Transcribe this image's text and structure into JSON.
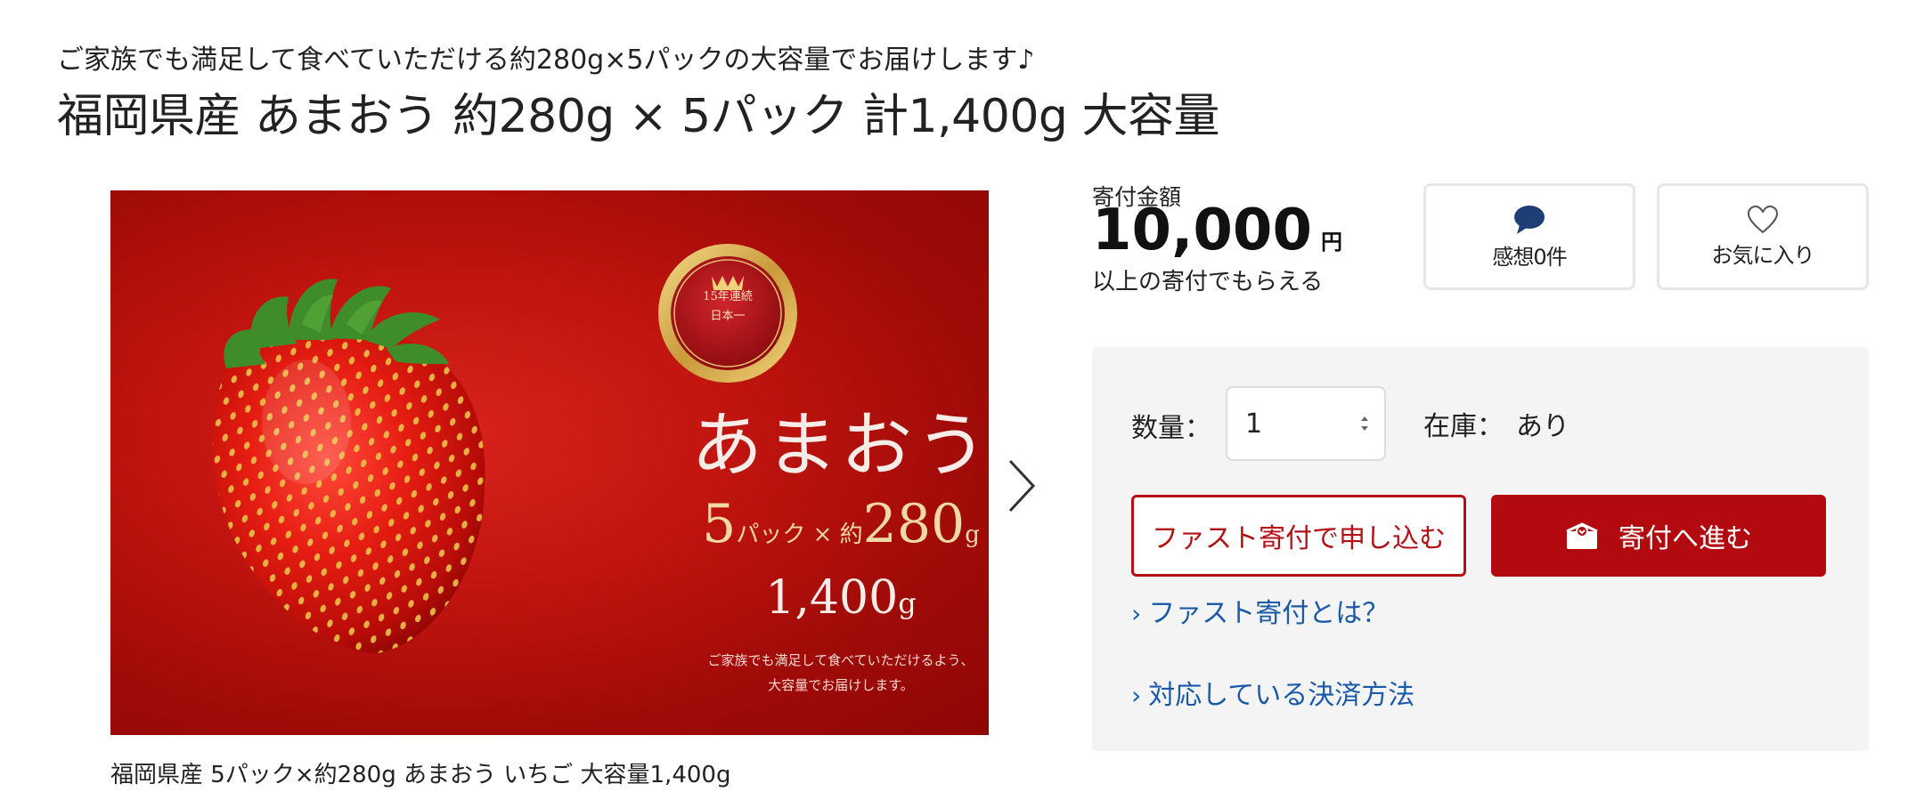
{
  "header": {
    "catch_copy": "ご家族でも満足して食べていただける約280g×5パックの大容量でお届けします♪",
    "title": "福岡県産 あまおう 約280g × 5パック 計1,400g 大容量"
  },
  "gallery": {
    "badge_line1": "15年連続",
    "badge_line2": "日本一",
    "product_name": "あまおう",
    "pack_count": "5",
    "pack_unit": "パック × 約",
    "pack_weight": "280",
    "weight_unit": "g",
    "total_number": "1,400",
    "total_unit": "g",
    "note_line1": "ご家族でも満足して食べていただけるよう、",
    "note_line2": "大容量でお届けします。",
    "caption": "福岡県産 5パック×約280g あまおう いちご 大容量1,400g",
    "next_icon": "chevron-right-icon"
  },
  "donation": {
    "label": "寄付金額",
    "amount": "10,000",
    "currency": "円",
    "sub": "以上の寄付でもらえる"
  },
  "actions": {
    "review_label": "感想0件",
    "review_icon": "speech-bubble-icon",
    "favorite_label": "お気に入り",
    "favorite_icon": "heart-icon"
  },
  "order": {
    "quantity_label": "数量：",
    "quantity_value": "1",
    "stock_label": "在庫：",
    "stock_value": "あり",
    "fast_button": "ファスト寄付で申し込む",
    "donate_button": "寄付へ進む",
    "donate_icon": "gift-box-icon",
    "link_fast": "ファスト寄付とは？",
    "link_payment": "対応している決済方法",
    "link_chevron": "›"
  },
  "colors": {
    "brand_red": "#b30a0f",
    "link_blue": "#1a5aa8",
    "icon_navy": "#1e3f75",
    "panel_bg": "#f4f4f4"
  }
}
